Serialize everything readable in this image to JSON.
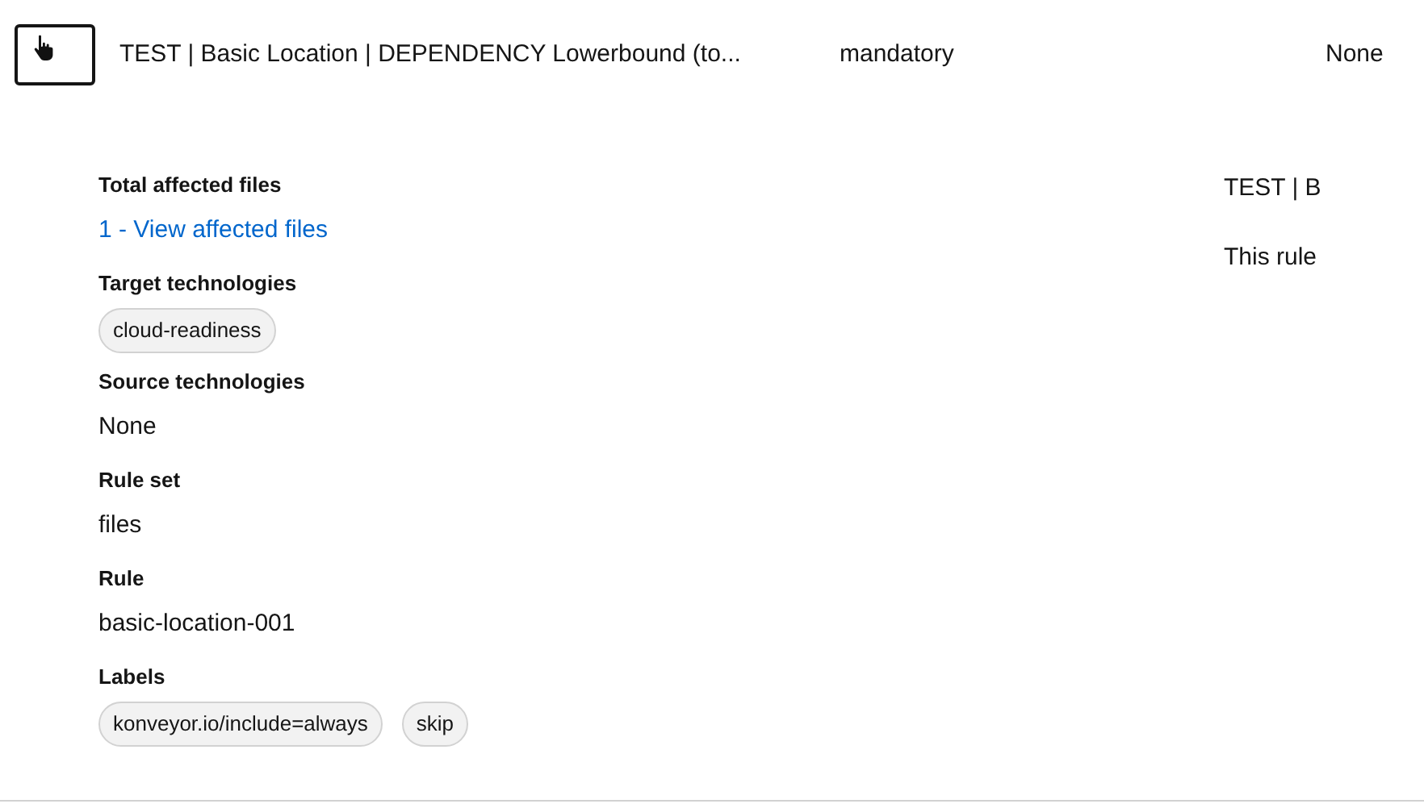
{
  "row": {
    "title": "TEST | Basic Location | DEPENDENCY Lowerbound (to...",
    "category": "mandatory",
    "effort": "None"
  },
  "details": [
    {
      "label": "Total affected files",
      "kind": "link",
      "value": "1 - View affected files"
    },
    {
      "label": "Target technologies",
      "kind": "chips",
      "chips": [
        "cloud-readiness"
      ]
    },
    {
      "label": "Source technologies",
      "kind": "text",
      "value": "None"
    },
    {
      "label": "Rule set",
      "kind": "text",
      "value": "files"
    },
    {
      "label": "Rule",
      "kind": "text",
      "value": "basic-location-001"
    },
    {
      "label": "Labels",
      "kind": "chips",
      "chips": [
        "konveyor.io/include=always",
        "skip"
      ]
    }
  ],
  "side": {
    "title": "TEST | B",
    "description": "This rule"
  }
}
